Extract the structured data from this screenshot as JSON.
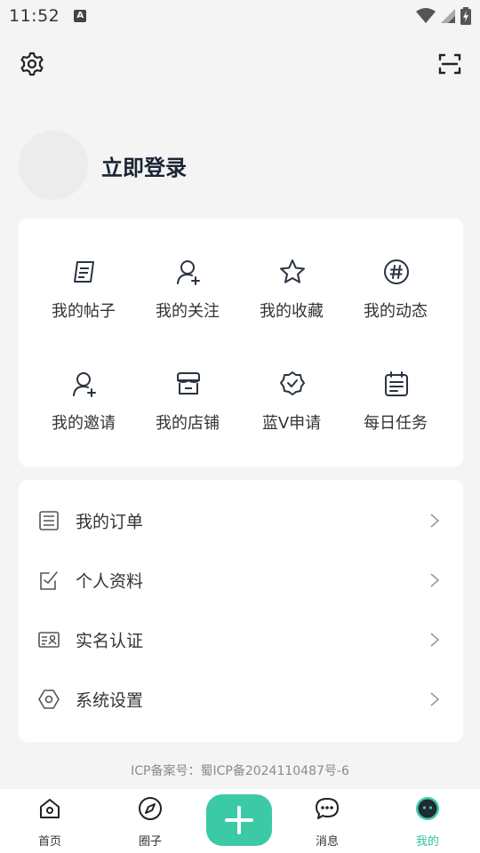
{
  "status_bar": {
    "time": "11:52",
    "notif_letter": "A"
  },
  "profile": {
    "login_label": "立即登录"
  },
  "grid": [
    {
      "label": "我的帖子",
      "icon": "post-icon"
    },
    {
      "label": "我的关注",
      "icon": "follow-user-icon"
    },
    {
      "label": "我的收藏",
      "icon": "star-icon"
    },
    {
      "label": "我的动态",
      "icon": "hashtag-icon"
    },
    {
      "label": "我的邀请",
      "icon": "invite-user-icon"
    },
    {
      "label": "我的店铺",
      "icon": "store-icon"
    },
    {
      "label": "蓝V申请",
      "icon": "verified-badge-icon"
    },
    {
      "label": "每日任务",
      "icon": "calendar-icon"
    }
  ],
  "menu": [
    {
      "label": "我的订单",
      "icon": "order-list-icon"
    },
    {
      "label": "个人资料",
      "icon": "edit-profile-icon"
    },
    {
      "label": "实名认证",
      "icon": "id-card-icon"
    },
    {
      "label": "系统设置",
      "icon": "hexagon-settings-icon"
    }
  ],
  "footer": {
    "icp": "ICP备案号：蜀ICP备2024110487号-6"
  },
  "bottom_nav": {
    "home": "首页",
    "circle": "圈子",
    "messages": "消息",
    "me": "我的"
  },
  "colors": {
    "accent": "#3cc9a6",
    "active_tab": "#2ec4a4",
    "text_dark": "#1b2433"
  }
}
